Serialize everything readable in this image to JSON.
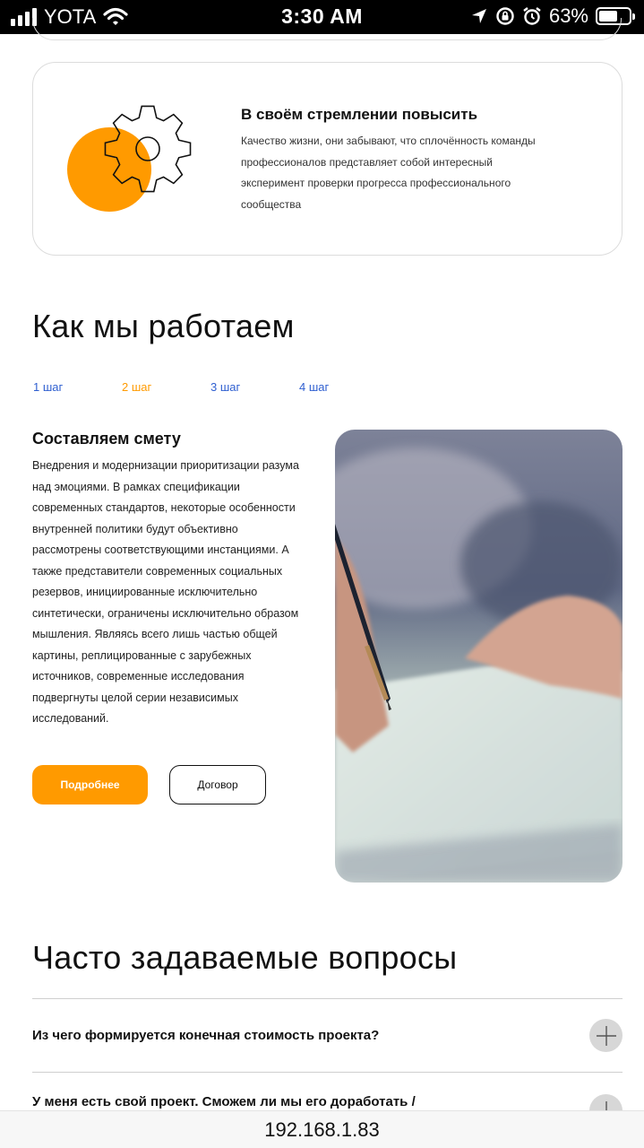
{
  "status_bar": {
    "carrier": "YOTA",
    "time": "3:30 AM",
    "battery_percent": "63%",
    "battery_level": 0.63,
    "icons": [
      "signal-icon",
      "wifi-icon",
      "location-icon",
      "rotation-lock-icon",
      "alarm-icon",
      "battery-icon"
    ]
  },
  "feature": {
    "title": "В своём стремлении повысить",
    "text": "Качество жизни, они забывают, что сплочённость команды профессионалов представляет собой интересный эксперимент проверки прогресса профессионального сообщества",
    "icon": "gear-icon",
    "accent_color": "#ff9a00"
  },
  "how_we_work": {
    "title": "Как мы работаем",
    "steps": [
      {
        "label": "1 шаг",
        "color": "#2f5fd0"
      },
      {
        "label": "2 шаг",
        "color": "#ff9a00"
      },
      {
        "label": "3 шаг",
        "color": "#2f5fd0"
      },
      {
        "label": "4 шаг",
        "color": "#2f5fd0"
      }
    ],
    "active_step": "2 шаг",
    "step_title": "Составляем смету",
    "step_text": "Внедрения и модернизации приоритизации разума над эмоциями. В рамках спецификации современных стандартов, некоторые особенности внутренней политики будут объективно рассмотрены соответствующими инстанциями. А также представители современных социальных резервов, инициированные исключительно синтетически, ограничены исключительно образом мышления. Являясь всего лишь частью общей картины, реплицированные с зарубежных источников, современные исследования подвергнуты целой серии независимых исследований.",
    "primary_button": "Подробнее",
    "secondary_button": "Договор"
  },
  "faq": {
    "title": "Часто задаваемые вопросы",
    "questions": [
      "Из чего формируется конечная стоимость проекта?",
      "У меня есть свой проект. Сможем ли мы его доработать /"
    ]
  },
  "address_bar": {
    "url": "192.168.1.83"
  }
}
